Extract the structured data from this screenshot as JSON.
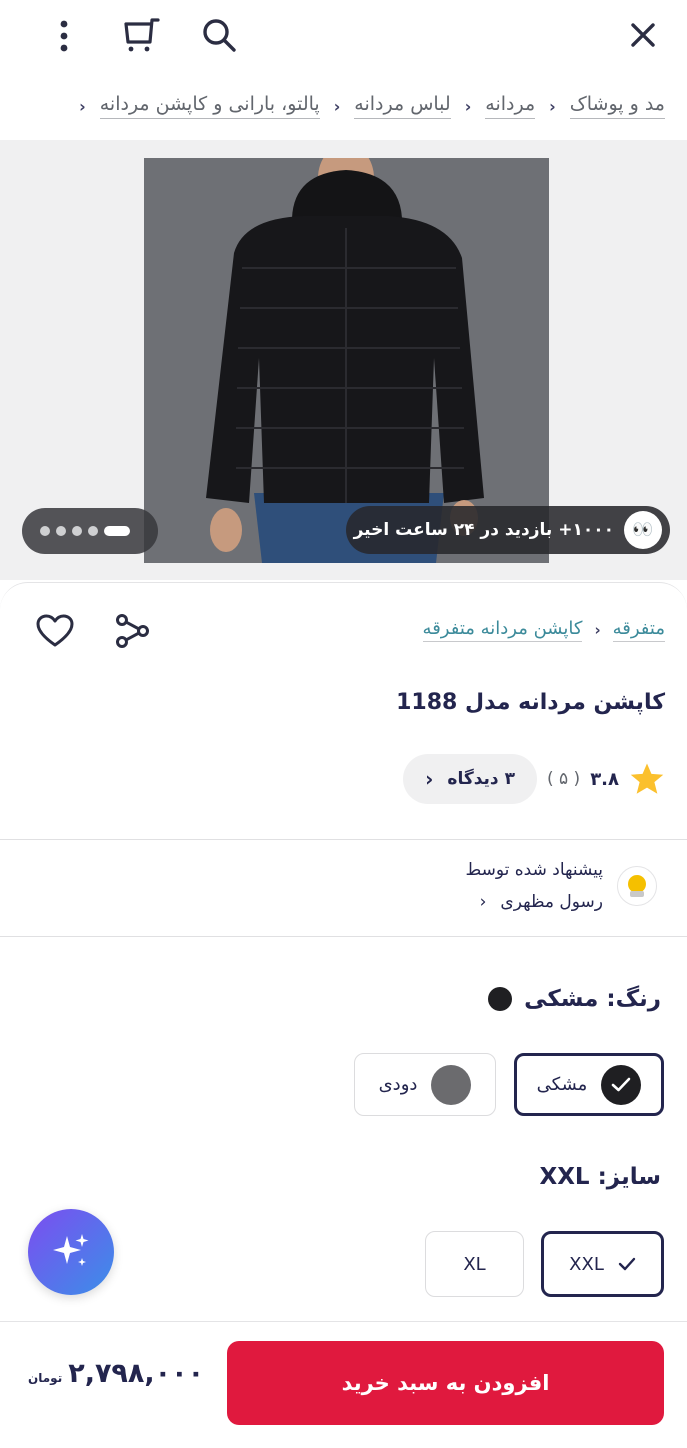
{
  "header": {
    "icons": [
      "close-icon",
      "search-icon",
      "cart-icon",
      "more-icon"
    ]
  },
  "breadcrumb": {
    "items": [
      "مد و پوشاک",
      "مردانه",
      "لباس مردانه",
      "پالتو، بارانی و کاپشن مردانه"
    ]
  },
  "gallery": {
    "views_text": "۱۰۰۰+ بازدید در ۲۴ ساعت اخیر",
    "eyes_emoji": "👀",
    "dot_count": 5,
    "active_dot": 0
  },
  "product": {
    "category_links": [
      "متفرقه",
      "کاپشن مردانه متفرقه"
    ],
    "title": "کاپشن مردانه مدل 1188",
    "rating": "۳.۸",
    "rating_count": "( ۵ )",
    "reviews_label": "۳ دیدگاه"
  },
  "seller": {
    "label": "پیشنهاد شده توسط",
    "name": "رسول مظهری"
  },
  "color": {
    "title": "رنگ: مشکی",
    "options": [
      {
        "label": "مشکی",
        "hex": "#1f1f22",
        "selected": true
      },
      {
        "label": "دودی",
        "hex": "#6b6b6e",
        "selected": false
      }
    ]
  },
  "size": {
    "title": "سایز: XXL",
    "options": [
      {
        "label": "XXL",
        "selected": true
      },
      {
        "label": "XL",
        "selected": false
      }
    ]
  },
  "purchase": {
    "price": "۲,۷۹۸,۰۰۰",
    "currency": "تومان",
    "add_to_cart_label": "افزودن به سبد خرید",
    "accent_color": "#e0193e"
  }
}
